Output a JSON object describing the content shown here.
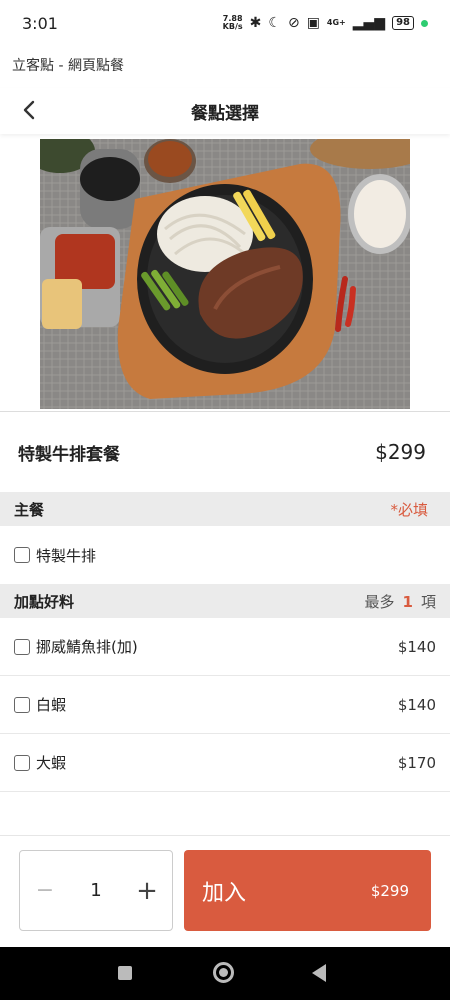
{
  "status": {
    "time": "3:01",
    "net_speed": "7.88",
    "net_unit": "KB/s",
    "network": "4G+",
    "battery": "98",
    "icons": [
      "bluetooth-icon",
      "moon-icon",
      "mute-icon",
      "volte-icon",
      "signal-icon",
      "battery-icon"
    ]
  },
  "app_title": "立客點 - 網頁點餐",
  "header": {
    "title": "餐點選擇"
  },
  "product": {
    "name": "特製牛排套餐",
    "price": "$299"
  },
  "sections": [
    {
      "title": "主餐",
      "required_label": "*必填",
      "options": [
        {
          "label": "特製牛排",
          "price": ""
        }
      ]
    },
    {
      "title": "加點好料",
      "limit_prefix": "最多",
      "limit_num": "1",
      "limit_suffix": "項",
      "options": [
        {
          "label": "挪威鯖魚排(加)",
          "price": "$140"
        },
        {
          "label": "白蝦",
          "price": "$140"
        },
        {
          "label": "大蝦",
          "price": "$170"
        }
      ]
    }
  ],
  "cart": {
    "minus": "−",
    "quantity": "1",
    "plus": "+",
    "add_label": "加入",
    "total": "$299"
  },
  "colors": {
    "accent": "#d95b3f",
    "section_bg": "#ebebeb"
  }
}
